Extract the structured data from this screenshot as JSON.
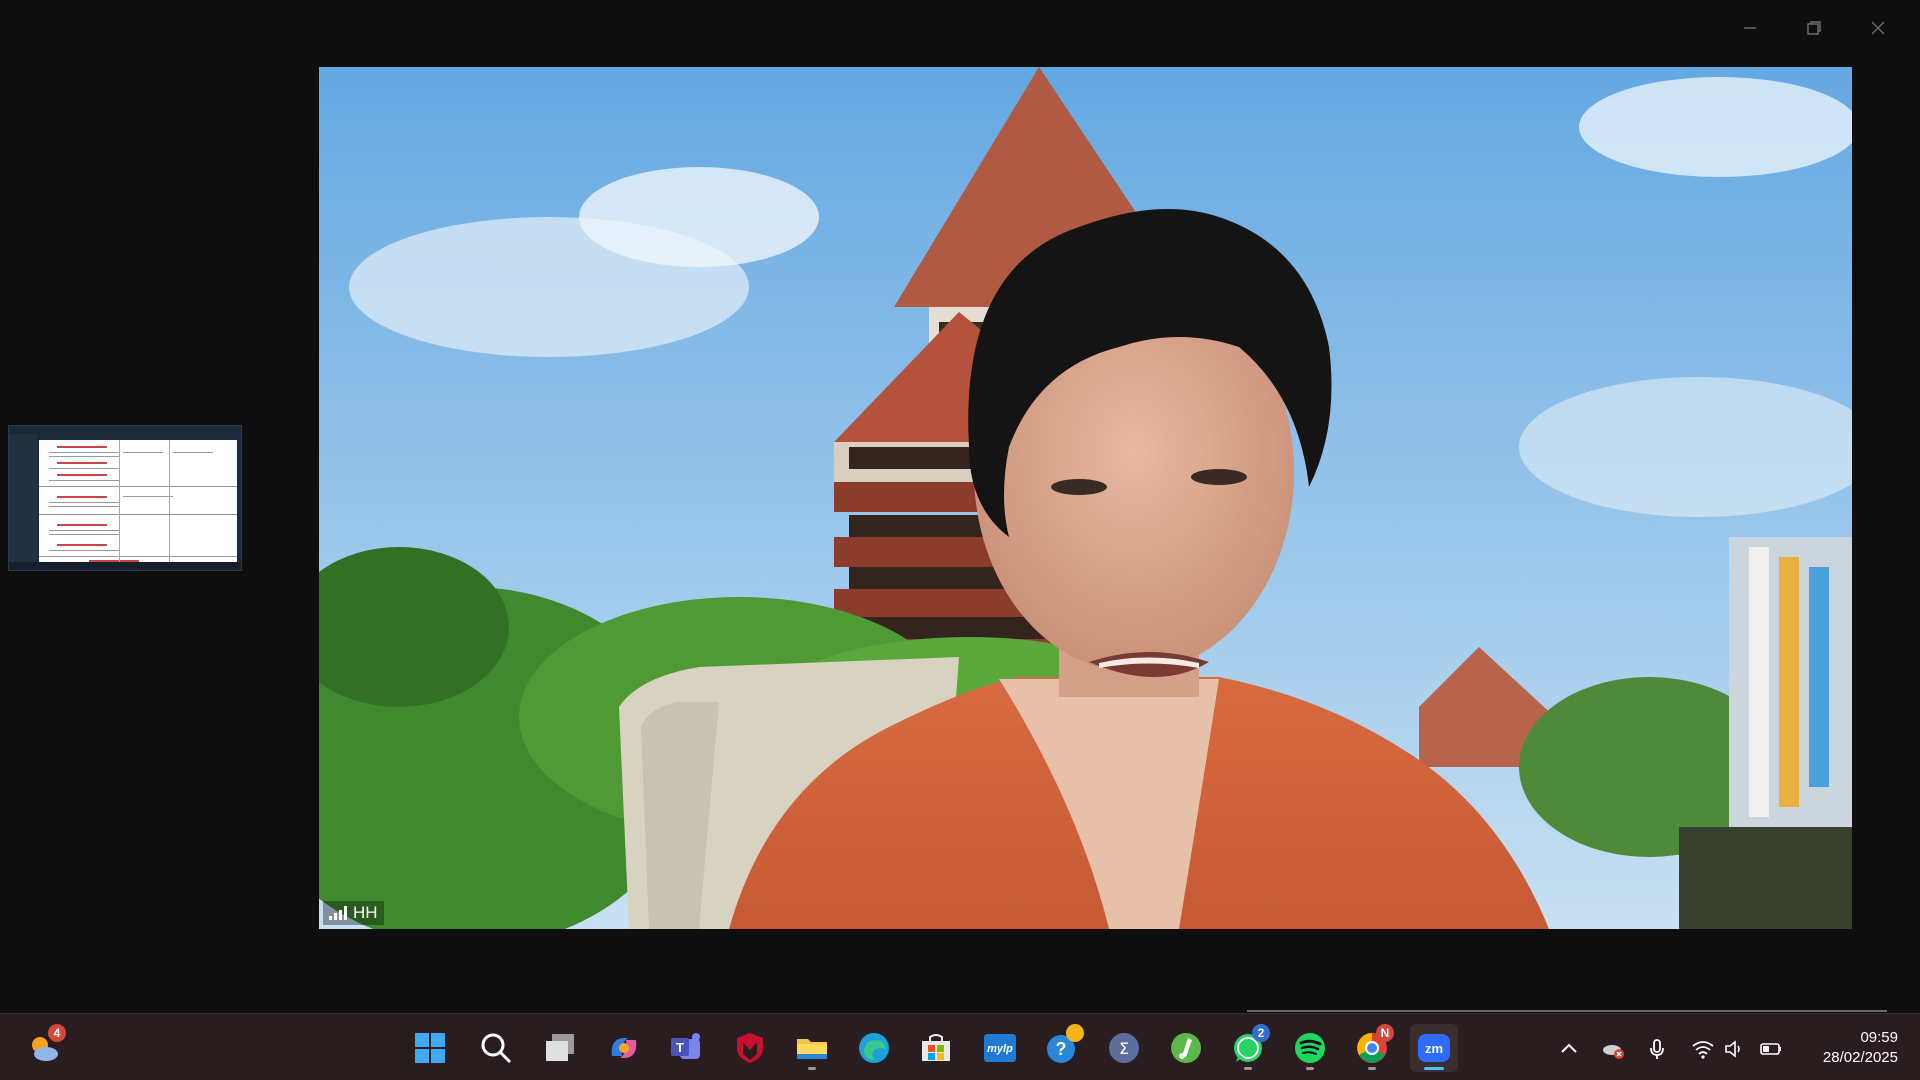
{
  "window": {
    "controls": {
      "minimize": "minimize",
      "maximize": "restore",
      "close": "close"
    }
  },
  "video": {
    "participant_name": "HH"
  },
  "taskbar": {
    "widgets_badge": "4",
    "whatsapp_badge": "2",
    "chrome_badge": "N",
    "zoom_label": "zm",
    "mylp_label": "mylp"
  },
  "clock": {
    "time": "09:59",
    "date": "28/02/2025"
  },
  "colors": {
    "accent": "#4cc2ff",
    "shirt": "#d2643c",
    "sky": "#7fb8e6",
    "roof": "#b8543e"
  }
}
